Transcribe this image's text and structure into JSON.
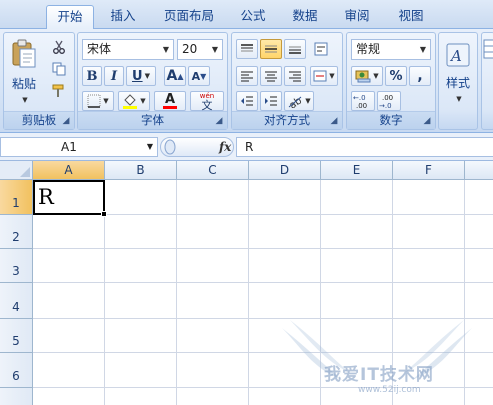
{
  "tabs": [
    {
      "label": "开始",
      "active": true
    },
    {
      "label": "插入",
      "active": false
    },
    {
      "label": "页面布局",
      "active": false
    },
    {
      "label": "公式",
      "active": false
    },
    {
      "label": "数据",
      "active": false
    },
    {
      "label": "审阅",
      "active": false
    },
    {
      "label": "视图",
      "active": false
    }
  ],
  "clipboard": {
    "group_label": "剪贴板",
    "paste_label": "粘贴"
  },
  "font": {
    "group_label": "字体",
    "font_name": "宋体",
    "font_size": "20",
    "bold": "B",
    "italic": "I",
    "underline": "U",
    "grow": "A",
    "shrink": "A",
    "phonetic_top": "wén",
    "phonetic_char": "文",
    "font_color_glyph": "A",
    "highlight_color": "#ffff00",
    "font_color": "#ff0000"
  },
  "alignment": {
    "group_label": "对齐方式"
  },
  "number": {
    "group_label": "数字",
    "format": "常规",
    "percent": "%",
    "comma": ",",
    "inc_decimal": "+.0 .00",
    "dec_decimal": ".00 →.0"
  },
  "styles": {
    "label": "样式"
  },
  "formula_bar": {
    "name_box": "A1",
    "fx": "fx",
    "content": "R"
  },
  "columns": [
    "A",
    "B",
    "C",
    "D",
    "E",
    "F"
  ],
  "rows": [
    "1",
    "2",
    "3",
    "4",
    "5",
    "6"
  ],
  "cells": {
    "A1": "R"
  },
  "watermark": {
    "text": "我爱IT技术网",
    "url": "www.52ij.com"
  },
  "colors": {
    "selection_header": "#f1c15f",
    "ribbon_text": "#15428b"
  }
}
